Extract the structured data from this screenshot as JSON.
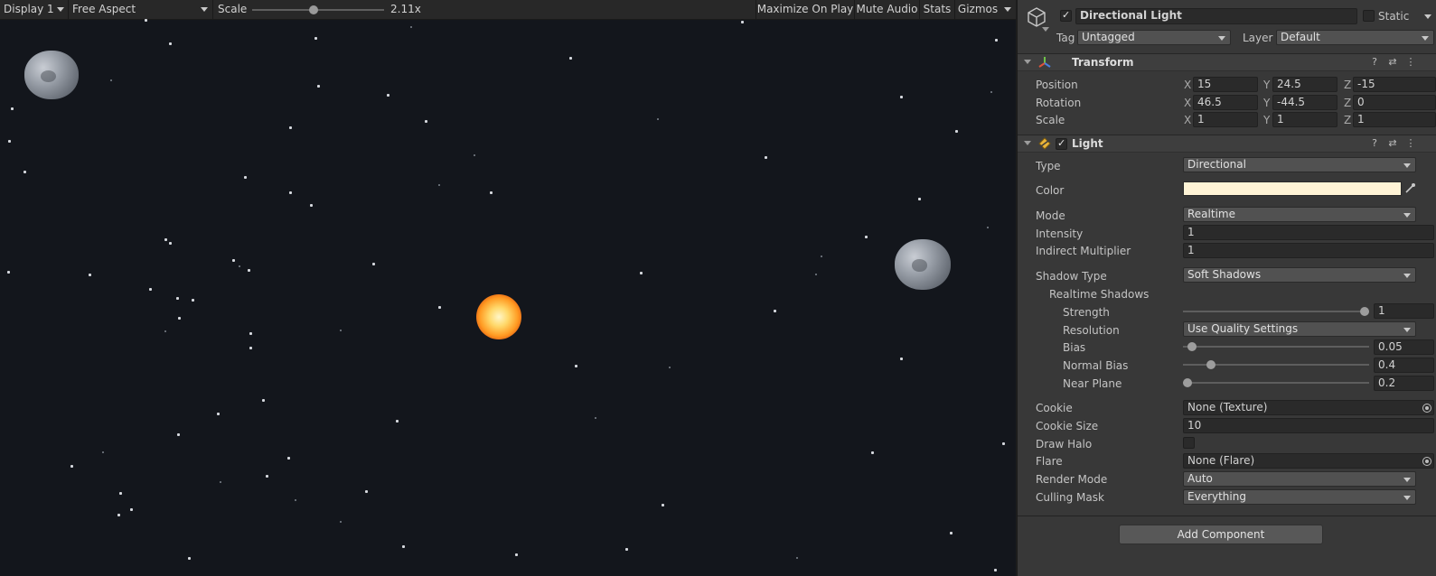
{
  "game_toolbar": {
    "display": "Display 1",
    "aspect": "Free Aspect",
    "scale_label": "Scale",
    "scale_value": "2.11x",
    "scale_fraction": 0.44,
    "buttons": [
      "Maximize On Play",
      "Mute Audio",
      "Stats",
      "Gizmos"
    ]
  },
  "inspector": {
    "object": {
      "enabled": true,
      "name": "Directional Light",
      "static_label": "Static",
      "static_checked": false,
      "tag_label": "Tag",
      "tag_value": "Untagged",
      "layer_label": "Layer",
      "layer_value": "Default"
    },
    "transform": {
      "title": "Transform",
      "rows": [
        {
          "label": "Position",
          "x": "15",
          "y": "24.5",
          "z": "-15"
        },
        {
          "label": "Rotation",
          "x": "46.5",
          "y": "-44.5",
          "z": "0"
        },
        {
          "label": "Scale",
          "x": "1",
          "y": "1",
          "z": "1"
        }
      ],
      "axis": {
        "x": "X",
        "y": "Y",
        "z": "Z"
      }
    },
    "light": {
      "title": "Light",
      "enabled": true,
      "type_label": "Type",
      "type_value": "Directional",
      "color_label": "Color",
      "color_value": "#fff4d6",
      "mode_label": "Mode",
      "mode_value": "Realtime",
      "intensity_label": "Intensity",
      "intensity_value": "1",
      "indirect_label": "Indirect Multiplier",
      "indirect_value": "1",
      "shadow_type_label": "Shadow Type",
      "shadow_type_value": "Soft Shadows",
      "realtime_shadows_label": "Realtime Shadows",
      "strength_label": "Strength",
      "strength_value": "1",
      "strength_fraction": 1.0,
      "resolution_label": "Resolution",
      "resolution_value": "Use Quality Settings",
      "bias_label": "Bias",
      "bias_value": "0.05",
      "bias_fraction": 0.025,
      "normal_bias_label": "Normal Bias",
      "normal_bias_value": "0.4",
      "normal_bias_fraction": 0.133,
      "near_plane_label": "Near Plane",
      "near_plane_value": "0.2",
      "near_plane_fraction": 0.0,
      "cookie_label": "Cookie",
      "cookie_value": "None (Texture)",
      "cookie_size_label": "Cookie Size",
      "cookie_size_value": "10",
      "draw_halo_label": "Draw Halo",
      "draw_halo_checked": false,
      "flare_label": "Flare",
      "flare_value": "None (Flare)",
      "render_mode_label": "Render Mode",
      "render_mode_value": "Auto",
      "culling_mask_label": "Culling Mask",
      "culling_mask_value": "Everything"
    },
    "add_component": "Add Component"
  }
}
